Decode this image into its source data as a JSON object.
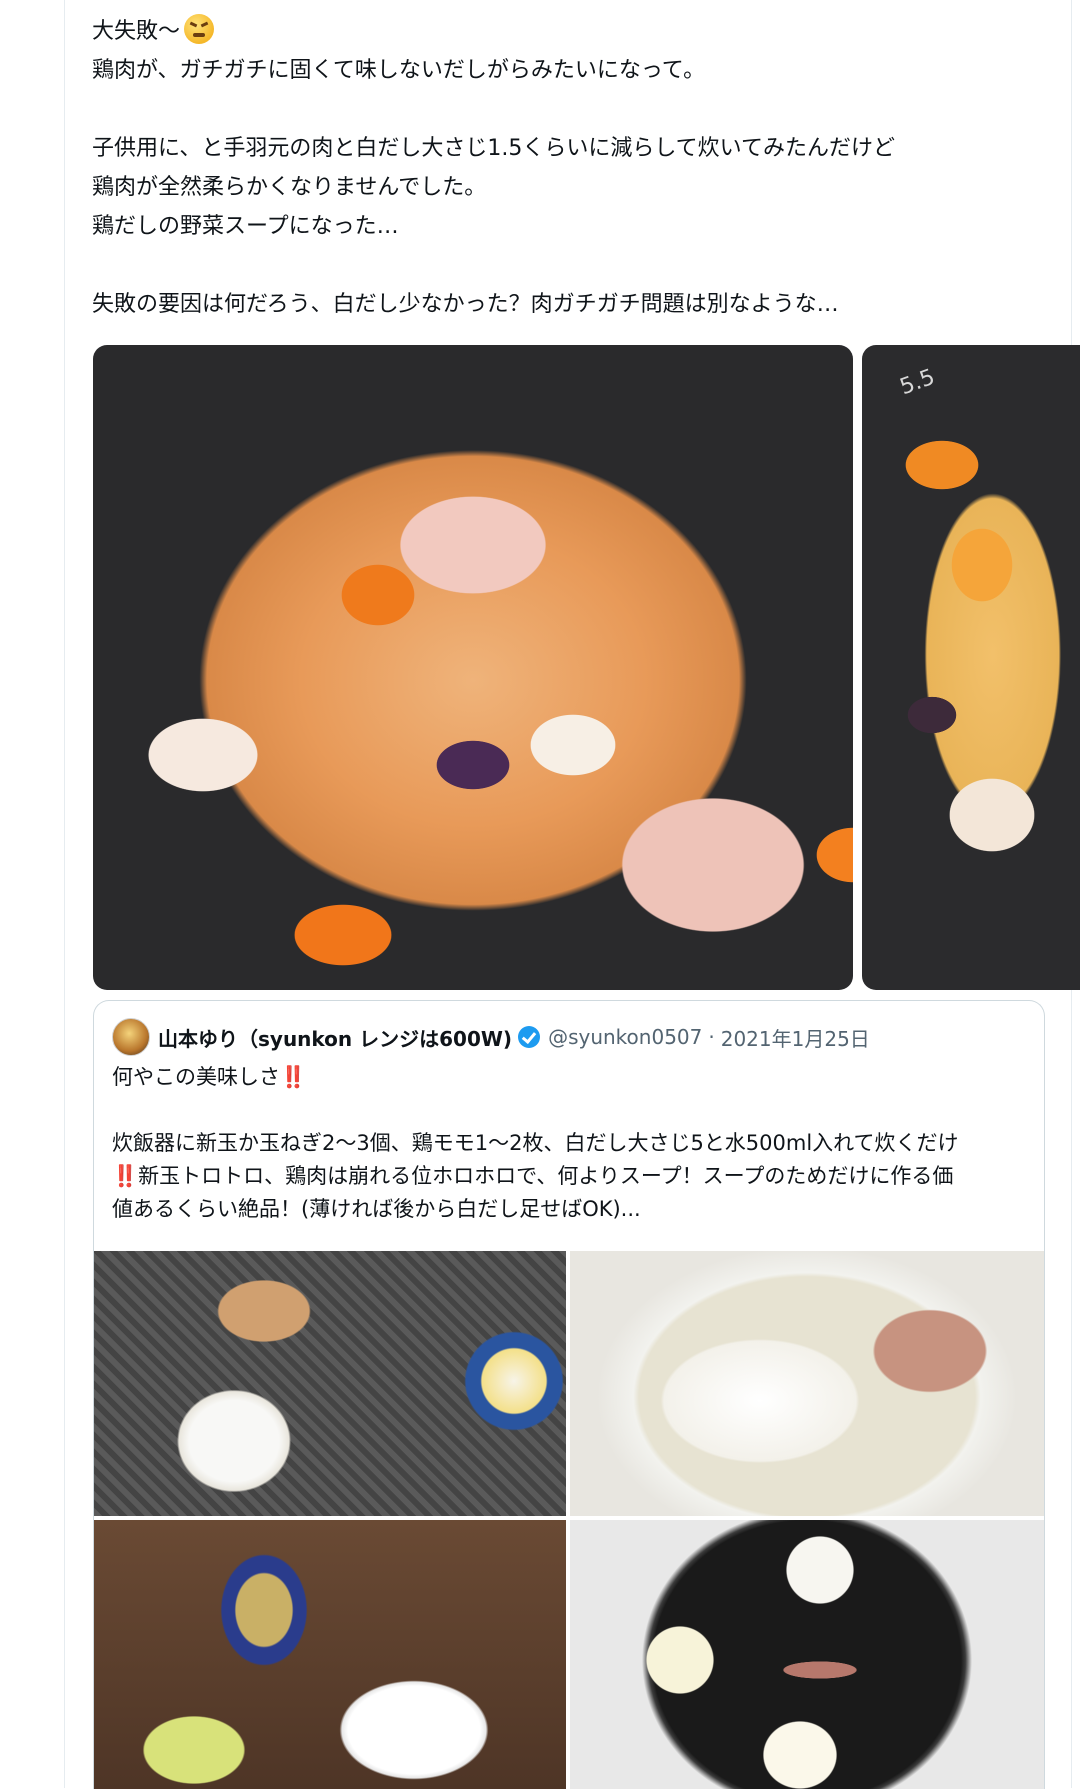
{
  "tweet": {
    "line1": "大失敗〜",
    "line1_emoji": "persevering-face",
    "line2": "鶏肉が、ガチガチに固くて味しないだしがらみたいになって。",
    "line3": "子供用に、と手羽元の肉と白だし大さじ1.5くらいに減らして炊いてみたんだけど",
    "line4": "鶏肉が全然柔らかくなりませんでした。",
    "line5": "鶏だしの野菜スープになった…",
    "line6": "失敗の要因は何だろう、白だし少なかった？肉ガチガチ問題は別なような…"
  },
  "media": {
    "photo1_alt": "炊飯器の中の鶏肉と野菜（調理前）",
    "photo2_alt": "炊飯器の中の野菜スープ（調理後）",
    "cooker_mark": "5.5"
  },
  "quote": {
    "name": "山本ゆり（syunkon レンジは600W)",
    "handle": "@syunkon0507",
    "separator": "·",
    "date": "2021年1月25日",
    "line1": "何やこの美味しさ",
    "line1_emoji": "‼️",
    "line2": "炊飯器に新玉か玉ねぎ2〜3個、鶏モモ1〜2枚、白だし大さじ5と水500ml入れて炊くだけ",
    "line3_emoji": "‼️",
    "line3": "新玉トロトロ、鶏肉は崩れる位ホロホロで、何よりスープ！スープのためだけに作る価",
    "line4": "値あるくらい絶品！(薄ければ後から白だし足せばOK)..."
  },
  "colors": {
    "text": "#0f1419",
    "muted": "#536471",
    "verified": "#1d9bf0",
    "border": "#cfd9de"
  }
}
